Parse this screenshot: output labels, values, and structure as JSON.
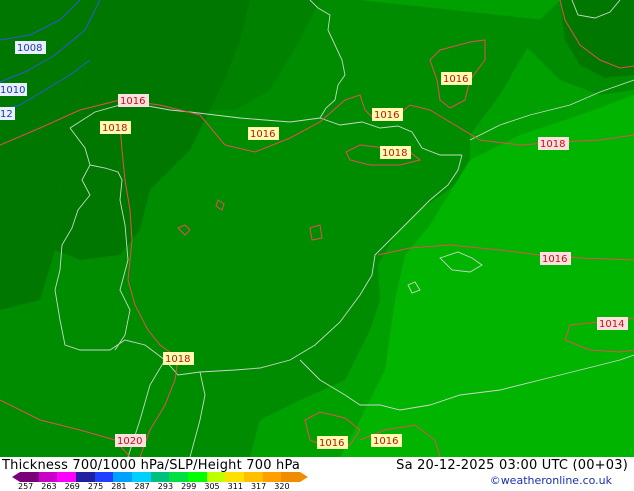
{
  "title": "Thickness 700/1000 hPa/SLP/Height 700 hPa",
  "datetime": "Sa 20-12-2025 03:00 UTC (00+03)",
  "credit": "©weatheronline.co.uk",
  "colors": {
    "dark_green": "#007800",
    "mid_green": "#008c00",
    "light_green": "#00a000",
    "bright_green": "#00b400",
    "contour_red": "#e05050",
    "contour_blue": "#2a5ad6",
    "coast_line": "#c8d8c8"
  },
  "scale": {
    "ticks": [
      "257",
      "263",
      "269",
      "275",
      "281",
      "287",
      "293",
      "299",
      "305",
      "311",
      "317",
      "320"
    ],
    "colors": [
      "#7a007a",
      "#c800c8",
      "#ff00ff",
      "#2020a0",
      "#2040ff",
      "#00a0ff",
      "#00d0ff",
      "#00c080",
      "#00e040",
      "#00ff00",
      "#c0ff00",
      "#ffe000",
      "#ffc000",
      "#ffa000",
      "#f08c00"
    ]
  },
  "isobar_labels": [
    {
      "text": "1008",
      "kind": "blue"
    },
    {
      "text": "1010",
      "kind": "blue"
    },
    {
      "text": "12",
      "kind": "blue"
    },
    {
      "text": "1016",
      "kind": "red"
    },
    {
      "text": "1018",
      "kind": "yellow"
    },
    {
      "text": "1016",
      "kind": "yellow"
    },
    {
      "text": "1016",
      "kind": "yellow"
    },
    {
      "text": "1016",
      "kind": "yellow"
    },
    {
      "text": "1018",
      "kind": "yellow"
    },
    {
      "text": "1018",
      "kind": "red"
    },
    {
      "text": "1016",
      "kind": "red"
    },
    {
      "text": "1014",
      "kind": "red"
    },
    {
      "text": "1018",
      "kind": "yellow"
    },
    {
      "text": "1020",
      "kind": "red"
    },
    {
      "text": "1016",
      "kind": "yellow"
    },
    {
      "text": "1016",
      "kind": "yellow"
    }
  ]
}
